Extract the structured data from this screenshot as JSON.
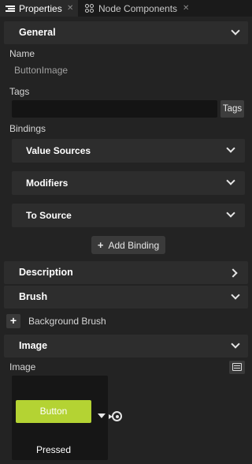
{
  "tabs": [
    {
      "label": "Properties",
      "icon": "list-icon",
      "active": true
    },
    {
      "label": "Node Components",
      "icon": "node-components-icon",
      "active": false
    }
  ],
  "sections": {
    "general": "General",
    "description": "Description",
    "brush": "Brush",
    "image": "Image"
  },
  "fields": {
    "name_label": "Name",
    "name_value": "ButtonImage",
    "tags_label": "Tags",
    "tags_button": "Tags",
    "bindings_label": "Bindings",
    "background_brush": "Background Brush",
    "image_label": "Image"
  },
  "bindings": {
    "value_sources": "Value Sources",
    "modifiers": "Modifiers",
    "to_source": "To Source",
    "add_binding": "Add Binding"
  },
  "preview": {
    "button_text": "Button",
    "caption": "Pressed",
    "button_color": "#b4d333"
  }
}
